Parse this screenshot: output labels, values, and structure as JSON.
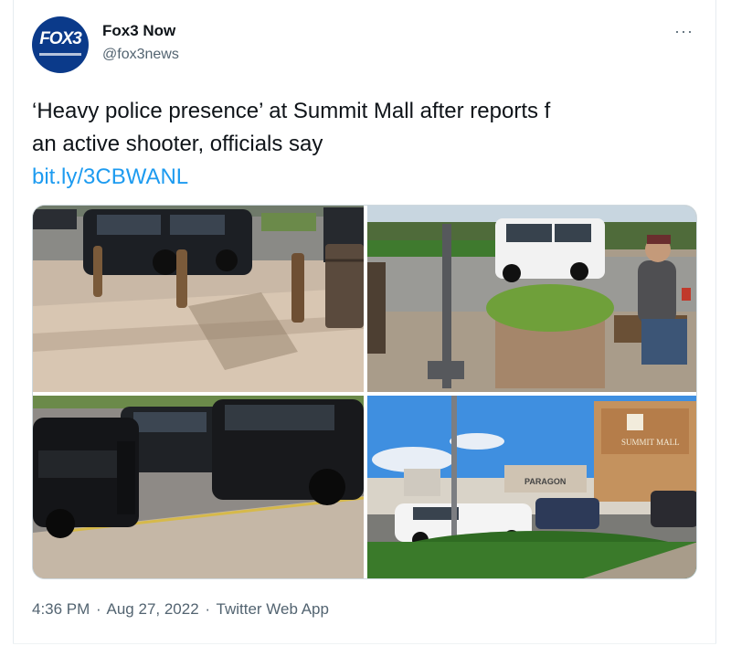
{
  "author": {
    "avatar_text": "FOX3",
    "display_name": "Fox3 Now",
    "handle": "@fox3news"
  },
  "menu": {
    "more_label": "···"
  },
  "tweet": {
    "text_line1": "‘Heavy police presence’ at Summit Mall after reports f",
    "text_line2": "an active shooter, officials say",
    "link_text": "bit.ly/3CBWANL"
  },
  "media": {
    "photos": [
      {
        "icon": "photo-police-suvs-parking-lot"
      },
      {
        "icon": "photo-police-suv-man-on-bench"
      },
      {
        "icon": "photo-police-suvs-close-up"
      },
      {
        "icon": "photo-summit-mall-exterior"
      }
    ],
    "mall_sign_text": "SUMMIT MALL"
  },
  "meta": {
    "time": "4:36 PM",
    "separator": "·",
    "date": "Aug 27, 2022",
    "source": "Twitter Web App"
  },
  "colors": {
    "link": "#1d9bf0",
    "secondary_text": "#536471",
    "avatar_bg": "#0b3a8a"
  }
}
